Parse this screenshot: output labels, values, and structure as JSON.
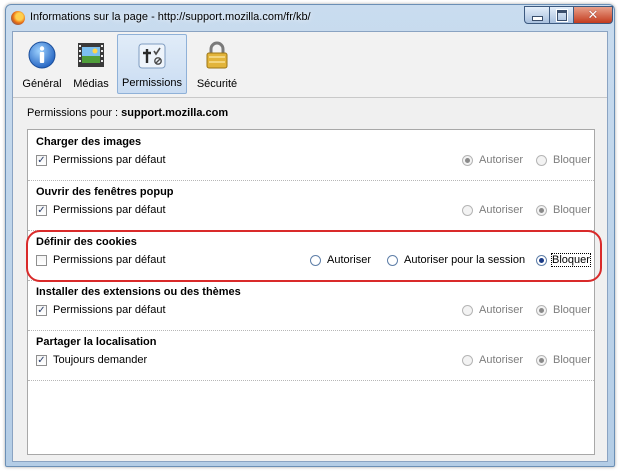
{
  "window": {
    "title": "Informations sur la page - http://support.mozilla.com/fr/kb/"
  },
  "toolbar": {
    "tabs": [
      {
        "label": "Général",
        "icon": "info-icon"
      },
      {
        "label": "Médias",
        "icon": "media-icon"
      },
      {
        "label": "Permissions",
        "icon": "permissions-icon",
        "selected": true
      },
      {
        "label": "Sécurité",
        "icon": "padlock-icon"
      }
    ]
  },
  "permissions": {
    "header_label": "Permissions pour :",
    "site": "support.mozilla.com",
    "groups": [
      {
        "title": "Charger des images",
        "checkbox_label": "Permissions par défaut",
        "checked": true,
        "options": [
          "Autoriser",
          "Bloquer"
        ],
        "selected": "Autoriser"
      },
      {
        "title": "Ouvrir des fenêtres popup",
        "checkbox_label": "Permissions par défaut",
        "checked": true,
        "options": [
          "Autoriser",
          "Bloquer"
        ],
        "selected": "Bloquer"
      },
      {
        "title": "Définir des cookies",
        "checkbox_label": "Permissions par défaut",
        "checked": false,
        "options": [
          "Autoriser",
          "Autoriser pour la session",
          "Bloquer"
        ],
        "selected": "Bloquer"
      },
      {
        "title": "Installer des extensions ou des thèmes",
        "checkbox_label": "Permissions par défaut",
        "checked": true,
        "options": [
          "Autoriser",
          "Bloquer"
        ],
        "selected": "Bloquer"
      },
      {
        "title": "Partager la localisation",
        "checkbox_label": "Toujours demander",
        "checked": true,
        "options": [
          "Autoriser",
          "Bloquer"
        ],
        "selected": "Bloquer"
      }
    ]
  },
  "colors": {
    "highlight": "#d92a2a",
    "titlebar": "#c9dcef",
    "selected_tab": "#c9dcf2"
  }
}
